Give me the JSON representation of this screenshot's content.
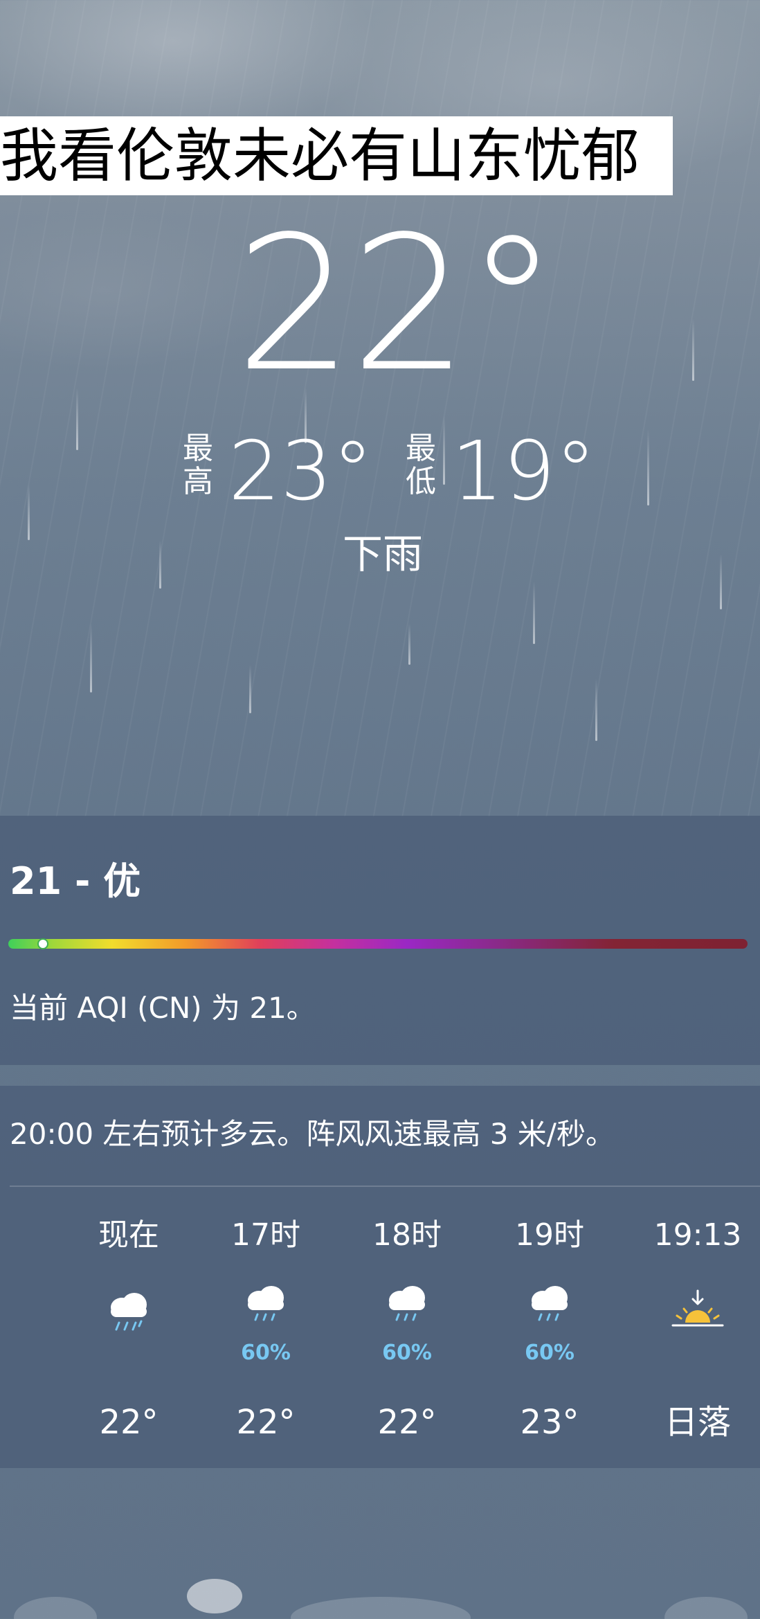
{
  "caption": "我看伦敦未必有山东忧郁",
  "current": {
    "temperature": "22°",
    "high_label": "最高",
    "high_value": "23°",
    "low_label": "最低",
    "low_value": "19°",
    "condition": "下雨"
  },
  "aqi": {
    "value_text": "21 - 优",
    "level": 21,
    "description": "当前 AQI (CN) 为 21。",
    "bar_colors": [
      "#3fcf5a",
      "#f2dc2c",
      "#f39a2a",
      "#e0405a",
      "#9a28c4",
      "#7e2232"
    ]
  },
  "hourly": {
    "summary": "20:00 左右预计多云。阵风风速最高 3 米/秒。",
    "items": [
      {
        "label": "现在",
        "icon": "rain-cloud-icon",
        "pop": "",
        "temp": "22°"
      },
      {
        "label": "17时",
        "icon": "rain-cloud-icon",
        "pop": "60%",
        "temp": "22°"
      },
      {
        "label": "18时",
        "icon": "rain-cloud-icon",
        "pop": "60%",
        "temp": "22°"
      },
      {
        "label": "19时",
        "icon": "rain-cloud-icon",
        "pop": "60%",
        "temp": "23°"
      },
      {
        "label": "19:13",
        "icon": "sunset-icon",
        "pop": "",
        "temp": "日落"
      }
    ]
  },
  "colors": {
    "pop_text": "#78c8f2",
    "sun": "#f6c23a",
    "card_bg": "#4a5c76"
  }
}
